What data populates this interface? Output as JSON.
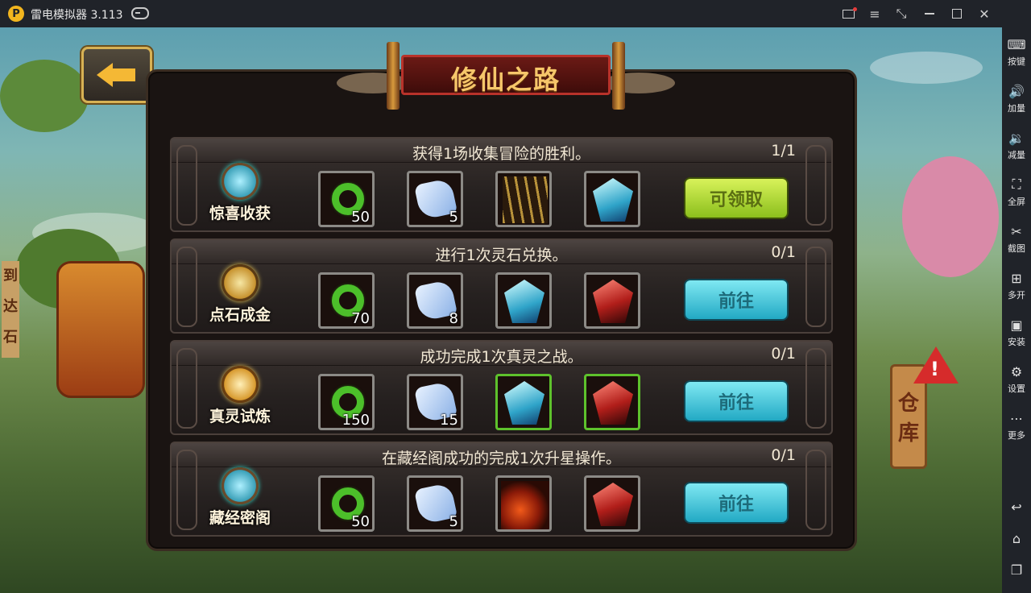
{
  "titlebar": {
    "app_name": "雷电模拟器",
    "version": "3.113"
  },
  "sidebar": {
    "items": [
      {
        "label": "按键",
        "icon": "keyboard-icon"
      },
      {
        "label": "加量",
        "icon": "volume-up-icon"
      },
      {
        "label": "减量",
        "icon": "volume-down-icon"
      },
      {
        "label": "全屏",
        "icon": "fullscreen-icon"
      },
      {
        "label": "截图",
        "icon": "scissors-icon"
      },
      {
        "label": "多开",
        "icon": "multi-instance-icon"
      },
      {
        "label": "安装",
        "icon": "apk-install-icon"
      },
      {
        "label": "设置",
        "icon": "gear-icon"
      },
      {
        "label": "更多",
        "icon": "more-dots-icon"
      }
    ],
    "nav": [
      "back-icon",
      "home-icon",
      "recent-apps-icon"
    ]
  },
  "game": {
    "title": "修仙之路",
    "warehouse_label": [
      "仓",
      "库"
    ],
    "side_text": [
      "到",
      "达",
      "石"
    ],
    "tasks": [
      {
        "name": "惊喜收获",
        "description": "获得1场收集冒险的胜利。",
        "progress": "1/1",
        "rewards": [
          {
            "icon": "jade-ring-icon",
            "qty": "50"
          },
          {
            "icon": "spirit-stone-icon",
            "qty": "5"
          },
          {
            "icon": "bamboo-icon",
            "qty": ""
          },
          {
            "icon": "blue-crystal-icon",
            "qty": ""
          }
        ],
        "action": "可领取"
      },
      {
        "name": "点石成金",
        "description": "进行1次灵石兑换。",
        "progress": "0/1",
        "rewards": [
          {
            "icon": "jade-ring-icon",
            "qty": "70"
          },
          {
            "icon": "spirit-stone-icon",
            "qty": "8"
          },
          {
            "icon": "blue-crystal-icon",
            "qty": ""
          },
          {
            "icon": "red-crystal-icon",
            "qty": ""
          }
        ],
        "action": "前往"
      },
      {
        "name": "真灵试炼",
        "description": "成功完成1次真灵之战。",
        "progress": "0/1",
        "rewards": [
          {
            "icon": "jade-ring-icon",
            "qty": "150"
          },
          {
            "icon": "spirit-stone-icon",
            "qty": "15"
          },
          {
            "icon": "blue-crystal-icon",
            "qty": ""
          },
          {
            "icon": "red-crystal-icon",
            "qty": ""
          }
        ],
        "action": "前往"
      },
      {
        "name": "藏经密阁",
        "description": "在藏经阁成功的完成1次升星操作。",
        "progress": "0/1",
        "rewards": [
          {
            "icon": "jade-ring-icon",
            "qty": "50"
          },
          {
            "icon": "spirit-stone-icon",
            "qty": "5"
          },
          {
            "icon": "fire-coral-icon",
            "qty": ""
          },
          {
            "icon": "red-crystal-icon",
            "qty": ""
          }
        ],
        "action": "前往"
      }
    ]
  }
}
